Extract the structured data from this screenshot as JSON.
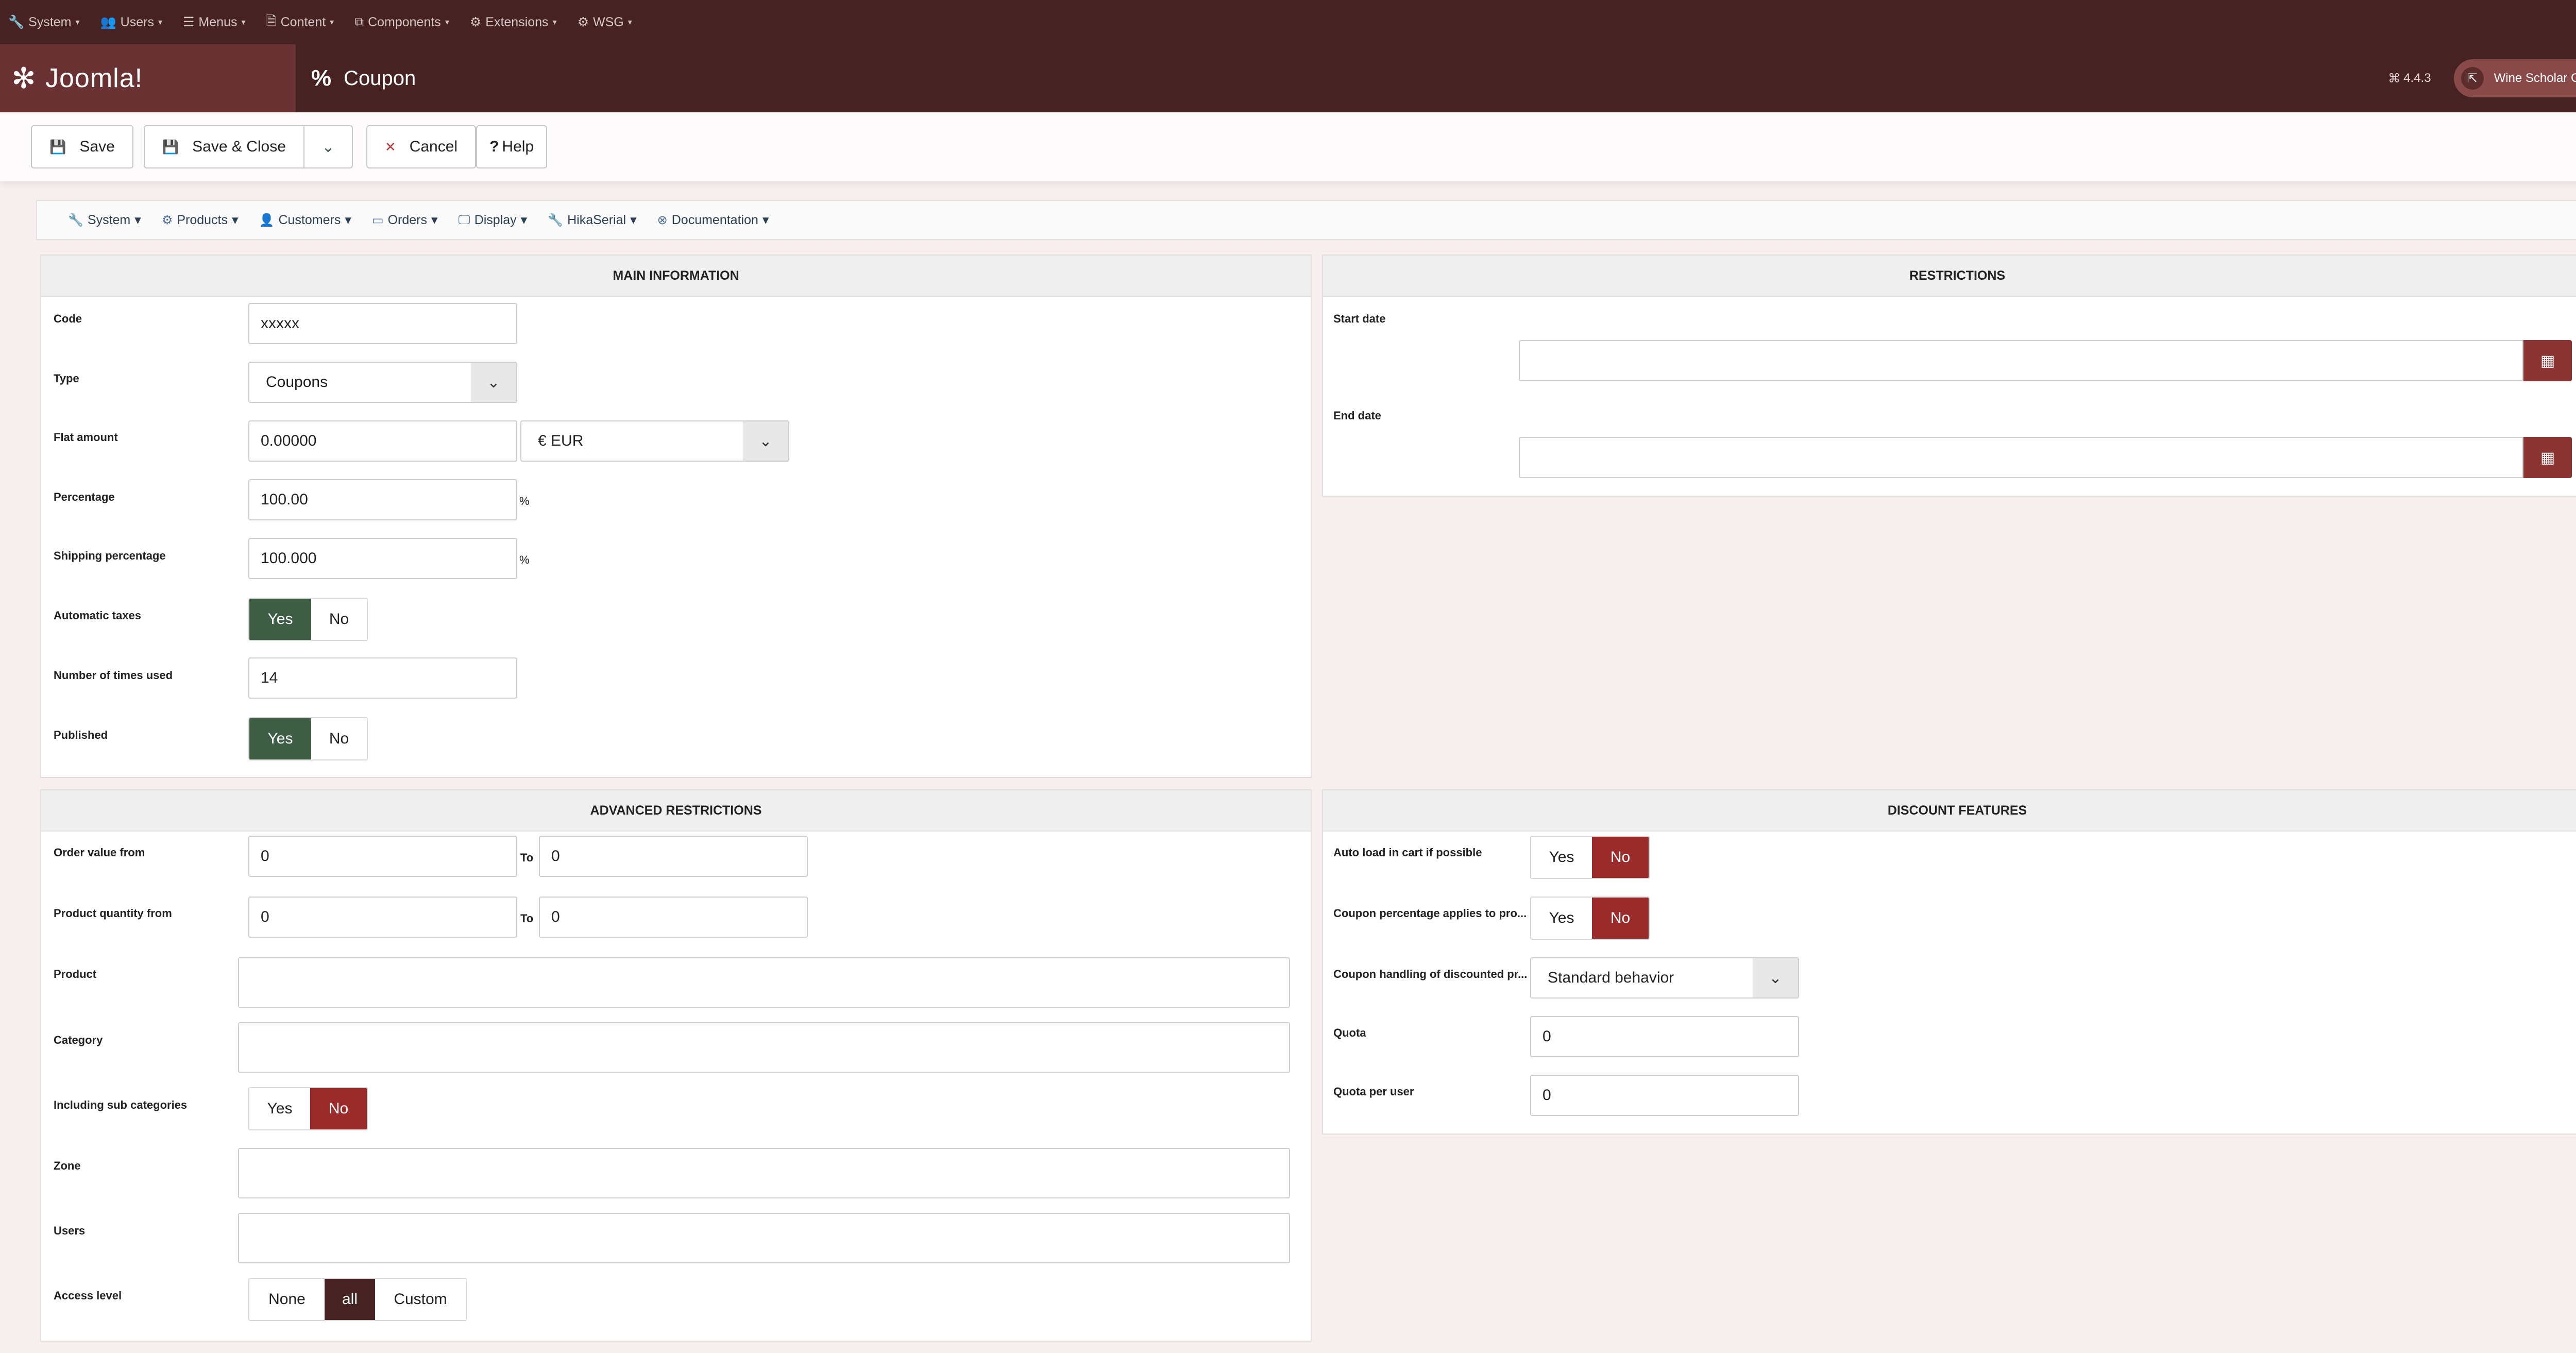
{
  "topmenu": [
    {
      "icon": "wrench-icon",
      "glyph": "🔧",
      "label": "System"
    },
    {
      "icon": "users-icon",
      "glyph": "👥",
      "label": "Users"
    },
    {
      "icon": "list-icon",
      "glyph": "☰",
      "label": "Menus"
    },
    {
      "icon": "file-icon",
      "glyph": "🗎",
      "label": "Content"
    },
    {
      "icon": "puzzle-icon",
      "glyph": "⧉",
      "label": "Components"
    },
    {
      "icon": "cubes-icon",
      "glyph": "⚙",
      "label": "Extensions"
    },
    {
      "icon": "cubes-icon",
      "glyph": "⚙",
      "label": "WSG"
    }
  ],
  "header": {
    "logo_text": "Joomla!",
    "title_icon": "%",
    "title": "Coupon",
    "version": "4.4.3",
    "site_button": "Wine Scholar Guild"
  },
  "toolbar": {
    "save": "Save",
    "save_close": "Save & Close",
    "cancel": "Cancel",
    "help": "Help"
  },
  "hikamenu": [
    {
      "icon": "wrench-icon",
      "glyph": "🔧",
      "label": "System"
    },
    {
      "icon": "cubes-icon",
      "glyph": "⚙",
      "label": "Products"
    },
    {
      "icon": "user-icon",
      "glyph": "👤",
      "label": "Customers"
    },
    {
      "icon": "credit-card-icon",
      "glyph": "▭",
      "label": "Orders"
    },
    {
      "icon": "display-icon",
      "glyph": "🖵",
      "label": "Display"
    },
    {
      "icon": "wrench-icon",
      "glyph": "🔧",
      "label": "HikaSerial"
    },
    {
      "icon": "lifebuoy-icon",
      "glyph": "⊗",
      "label": "Documentation"
    }
  ],
  "main": {
    "title": "MAIN INFORMATION",
    "code_label": "Code",
    "code_value": "xxxxx",
    "type_label": "Type",
    "type_value": "Coupons",
    "flat_label": "Flat amount",
    "flat_value": "0.00000",
    "currency_value": "€ EUR",
    "percentage_label": "Percentage",
    "percentage_value": "100.00",
    "percentage_unit": "%",
    "shipping_label": "Shipping percentage",
    "shipping_value": "100.000",
    "shipping_unit": "%",
    "autotax_label": "Automatic taxes",
    "yes": "Yes",
    "no": "No",
    "times_used_label": "Number of times used",
    "times_used_value": "14",
    "published_label": "Published"
  },
  "restrictions": {
    "title": "RESTRICTIONS",
    "start_label": "Start date",
    "start_value": "",
    "end_label": "End date",
    "end_value": ""
  },
  "advanced": {
    "title": "ADVANCED RESTRICTIONS",
    "order_from_label": "Order value from",
    "order_from_value": "0",
    "to": "To",
    "order_to_value": "0",
    "qty_from_label": "Product quantity from",
    "qty_from_value": "0",
    "qty_to_value": "0",
    "product_label": "Product",
    "category_label": "Category",
    "subcat_label": "Including sub categories",
    "zone_label": "Zone",
    "users_label": "Users",
    "access_label": "Access level",
    "access_none": "None",
    "access_all": "all",
    "access_custom": "Custom"
  },
  "discount": {
    "title": "DISCOUNT FEATURES",
    "autoload_label": "Auto load in cart if possible",
    "percent_applies_label": "Coupon percentage applies to pro...",
    "handling_label": "Coupon handling of discounted pr...",
    "handling_value": "Standard behavior",
    "quota_label": "Quota",
    "quota_value": "0",
    "quota_user_label": "Quota per user",
    "quota_user_value": "0"
  },
  "colors": {
    "header_bg": "#462222",
    "logo_bg": "#6a3232",
    "yes_active": "#3d5e45",
    "no_active": "#9b2a2a",
    "calendar_button": "#8a3434"
  }
}
